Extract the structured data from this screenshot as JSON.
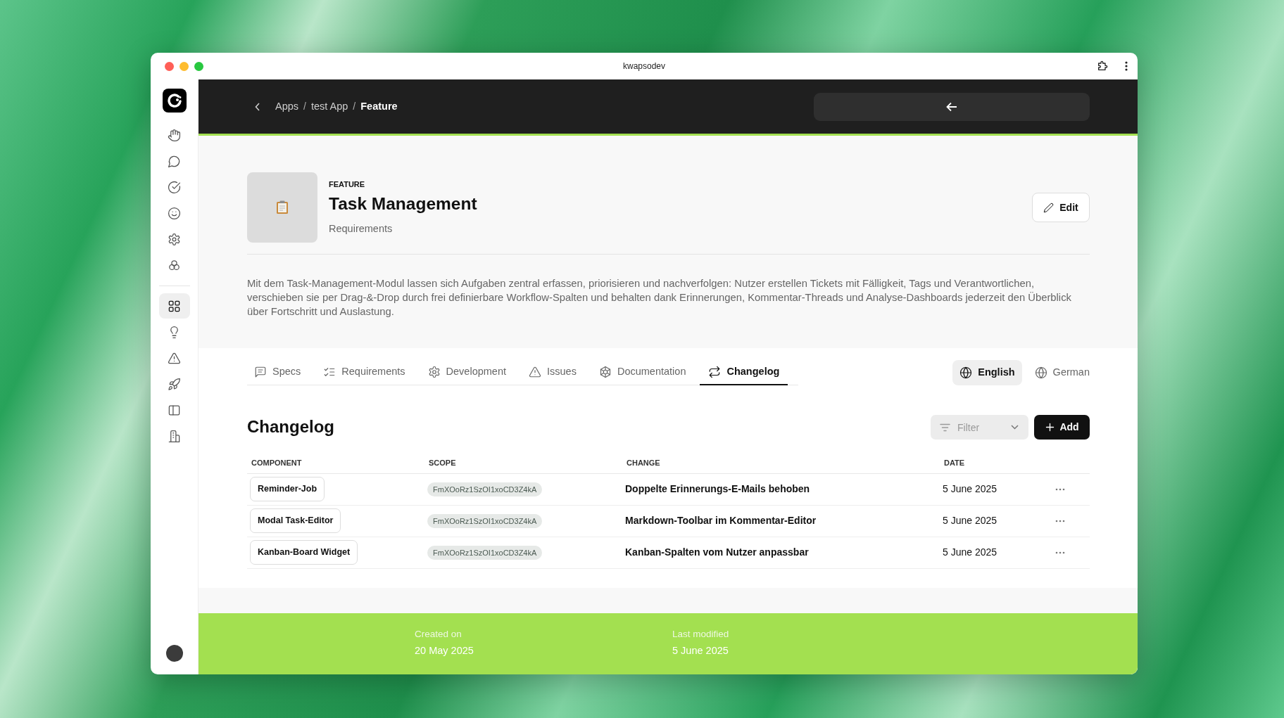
{
  "window": {
    "title": "kwapsodev"
  },
  "sidebar": {
    "items": [
      {
        "selected": false
      },
      {
        "selected": false
      },
      {
        "selected": false
      },
      {
        "selected": false
      },
      {
        "selected": false
      },
      {
        "selected": false
      },
      {
        "selected": true
      },
      {
        "selected": false
      },
      {
        "selected": false
      },
      {
        "selected": false
      },
      {
        "selected": false
      },
      {
        "selected": false
      }
    ]
  },
  "breadcrumb": {
    "items": [
      "Apps",
      "test App",
      "Feature"
    ],
    "separator": "/"
  },
  "feature": {
    "kicker": "FEATURE",
    "title": "Task Management",
    "subtitle": "Requirements",
    "edit_button": "Edit",
    "description": "Mit dem Task-Management-Modul lassen sich Aufgaben zentral erfassen, priorisieren und nachverfolgen: Nutzer erstellen Tickets mit Fälligkeit, Tags und Verantwortlichen, verschieben sie per Drag-&-Drop durch frei definierbare Workflow-Spalten und behalten dank Erinnerungen, Kommentar-Threads und Analyse-Dashboards jederzeit den Überblick über Fortschritt und Auslastung."
  },
  "tabs": [
    {
      "label": "Specs",
      "selected": false
    },
    {
      "label": "Requirements",
      "selected": false
    },
    {
      "label": "Development",
      "selected": false
    },
    {
      "label": "Issues",
      "selected": false
    },
    {
      "label": "Documentation",
      "selected": false
    },
    {
      "label": "Changelog",
      "selected": true
    }
  ],
  "languages": [
    {
      "label": "English",
      "selected": true
    },
    {
      "label": "German",
      "selected": false
    }
  ],
  "changelog": {
    "title": "Changelog",
    "filter": {
      "placeholder": "Filter"
    },
    "add_button": "Add",
    "columns": [
      "COMPONENT",
      "SCOPE",
      "CHANGE",
      "DATE"
    ],
    "rows": [
      {
        "component": "Reminder-Job",
        "scope": "FmXOoRz1SzOI1xoCD3Z4kA",
        "change": "Doppelte Erinnerungs-E-Mails behoben",
        "date": "5 June 2025"
      },
      {
        "component": "Modal Task-Editor",
        "scope": "FmXOoRz1SzOI1xoCD3Z4kA",
        "change": "Markdown-Toolbar im Kommentar-Editor",
        "date": "5 June 2025"
      },
      {
        "component": "Kanban-Board Widget",
        "scope": "FmXOoRz1SzOI1xoCD3Z4kA",
        "change": "Kanban-Spalten vom Nutzer anpassbar",
        "date": "5 June 2025"
      }
    ]
  },
  "footer": [
    {
      "label": "Created on",
      "value": "20 May 2025"
    },
    {
      "label": "Last modified",
      "value": "5 June 2025"
    }
  ]
}
